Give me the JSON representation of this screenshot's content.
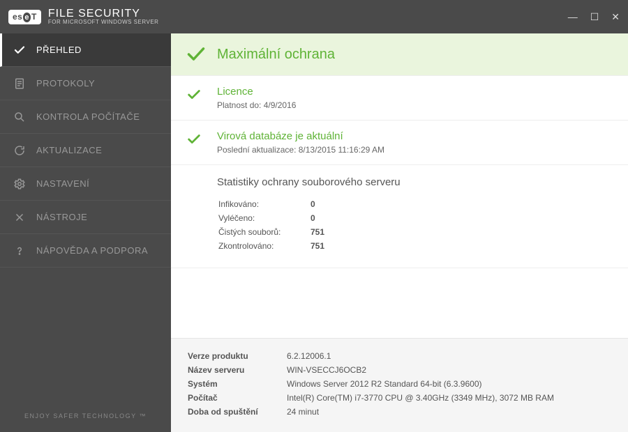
{
  "brand": {
    "logo_text": "eseT",
    "title": "FILE SECURITY",
    "subtitle": "FOR MICROSOFT WINDOWS SERVER"
  },
  "sidebar": {
    "items": [
      {
        "label": "PŘEHLED"
      },
      {
        "label": "PROTOKOLY"
      },
      {
        "label": "KONTROLA POČÍTAČE"
      },
      {
        "label": "AKTUALIZACE"
      },
      {
        "label": "NASTAVENÍ"
      },
      {
        "label": "NÁSTROJE"
      },
      {
        "label": "NÁPOVĚDA A PODPORA"
      }
    ],
    "footer": "ENJOY SAFER TECHNOLOGY ™"
  },
  "banner": {
    "title": "Maximální ochrana"
  },
  "license": {
    "title": "Licence",
    "sub_label": "Platnost do:",
    "sub_value": "4/9/2016"
  },
  "database": {
    "title": "Virová databáze je aktuální",
    "sub_label": "Poslední aktualizace:",
    "sub_value": "8/13/2015 11:16:29 AM"
  },
  "stats": {
    "title": "Statistiky ochrany souborového serveru",
    "rows": [
      {
        "label": "Infikováno:",
        "value": "0"
      },
      {
        "label": "Vyléčeno:",
        "value": "0"
      },
      {
        "label": "Čistých souborů:",
        "value": "751"
      },
      {
        "label": "Zkontrolováno:",
        "value": "751"
      }
    ]
  },
  "footer": {
    "rows": [
      {
        "label": "Verze produktu",
        "value": "6.2.12006.1"
      },
      {
        "label": "Název serveru",
        "value": "WIN-VSECCJ6OCB2"
      },
      {
        "label": "Systém",
        "value": "Windows Server 2012 R2 Standard 64-bit (6.3.9600)"
      },
      {
        "label": "Počítač",
        "value": "Intel(R) Core(TM) i7-3770 CPU @ 3.40GHz (3349 MHz), 3072 MB RAM"
      },
      {
        "label": "Doba od spuštění",
        "value": "24 minut"
      }
    ]
  }
}
